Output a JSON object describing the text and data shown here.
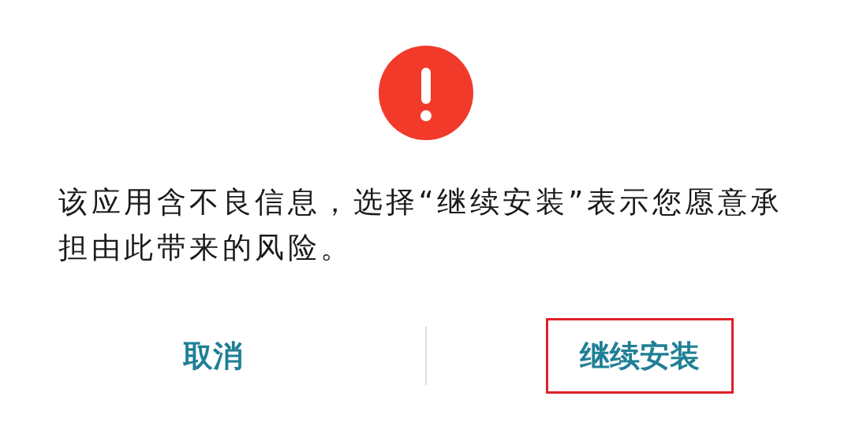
{
  "dialog": {
    "message": "该应用含不良信息，选择“继续安装”表示您愿意承担由此带来的风险。",
    "buttons": [
      {
        "label": "取消",
        "highlighted": false
      },
      {
        "label": "继续安装",
        "highlighted": true
      }
    ]
  }
}
